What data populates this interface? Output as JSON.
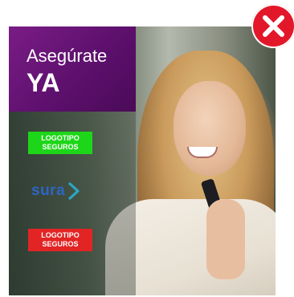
{
  "ad": {
    "headline_line1": "Asegúrate",
    "headline_line2": "YA",
    "logo_green_label": "LOGOTIPO SEGUROS",
    "logo_red_label": "LOGOTIPO SEGUROS",
    "brand_name": "sura"
  },
  "colors": {
    "headline_bg": "#6a1579",
    "logo_green": "#1ed619",
    "logo_red": "#e22424",
    "brand_blue": "#2d66c4",
    "close_red": "#e2182a"
  },
  "icons": [
    "close-x-icon",
    "sura-chevron-icon"
  ]
}
